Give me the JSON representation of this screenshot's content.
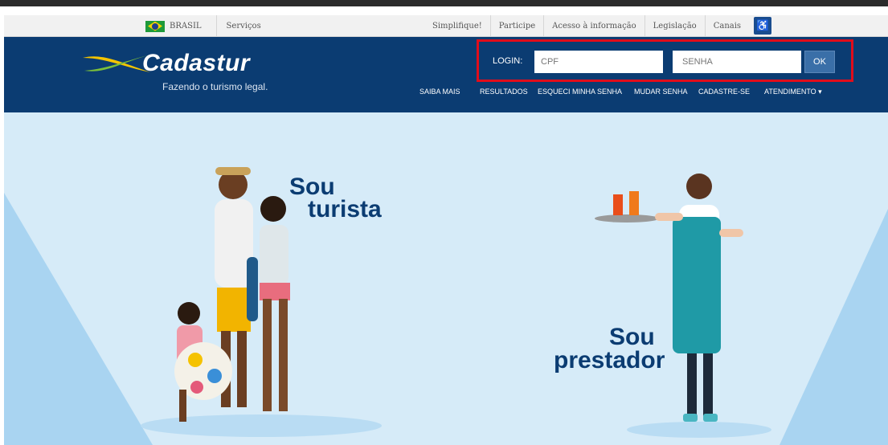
{
  "gov_bar": {
    "country": "BRASIL",
    "services": "Serviços",
    "links": [
      "Simplifique!",
      "Participe",
      "Acesso à informação",
      "Legislação",
      "Canais"
    ]
  },
  "header": {
    "logo_text": "Cadastur",
    "tagline": "Fazendo o turismo legal.",
    "login_label": "LOGIN:",
    "cpf_placeholder": "CPF",
    "senha_placeholder": "SENHA",
    "ok_label": "OK"
  },
  "nav": {
    "saiba_mais": "SAIBA MAIS",
    "resultados": "RESULTADOS",
    "esqueci": "ESQUECI MINHA SENHA",
    "mudar": "MUDAR SENHA",
    "cadastre": "CADASTRE-SE",
    "atendimento": "ATENDIMENTO ▾"
  },
  "hero": {
    "turista_line1": "Sou",
    "turista_line2": "turista",
    "prestador_line1": "Sou",
    "prestador_line2": "prestador"
  },
  "colors": {
    "header_bg": "#0b3c72",
    "hero_bg": "#d6ebf8",
    "highlight_border": "#e10d1b"
  }
}
